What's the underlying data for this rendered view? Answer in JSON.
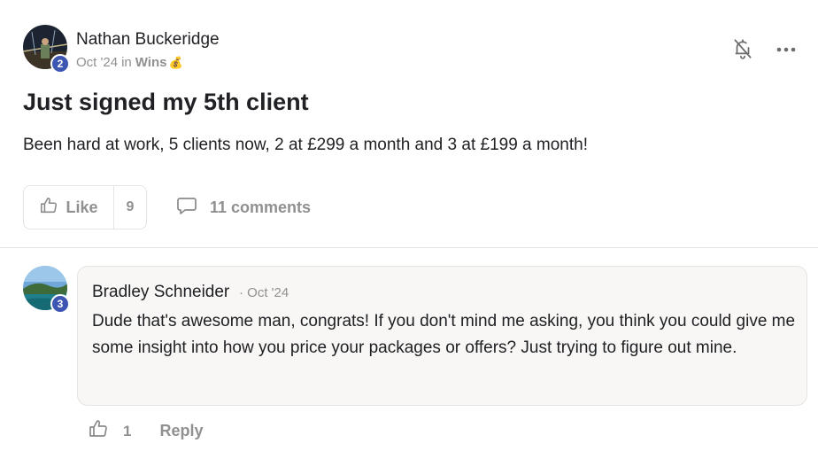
{
  "post": {
    "author": "Nathan Buckeridge",
    "author_level": "2",
    "date": "Oct '24",
    "in_word": "in",
    "category": "Wins",
    "category_emoji": "💰",
    "title": "Just signed my 5th client",
    "body": "Been hard at work, 5 clients now, 2 at £299 a month and 3 at £199 a month!",
    "like_label": "Like",
    "like_count": "9",
    "comments_label": "11 comments"
  },
  "comment": {
    "author": "Bradley Schneider",
    "author_level": "3",
    "date": "· Oct '24",
    "body": "Dude that's awesome man, congrats! If you don't mind me asking, you think you could give me some insight into how you price your packages or offers? Just trying to figure out mine.",
    "like_count": "1",
    "reply_label": "Reply"
  },
  "colors": {
    "level_badge": "#3d56b2",
    "muted_text": "#909090",
    "bubble_bg": "#f8f7f5"
  }
}
